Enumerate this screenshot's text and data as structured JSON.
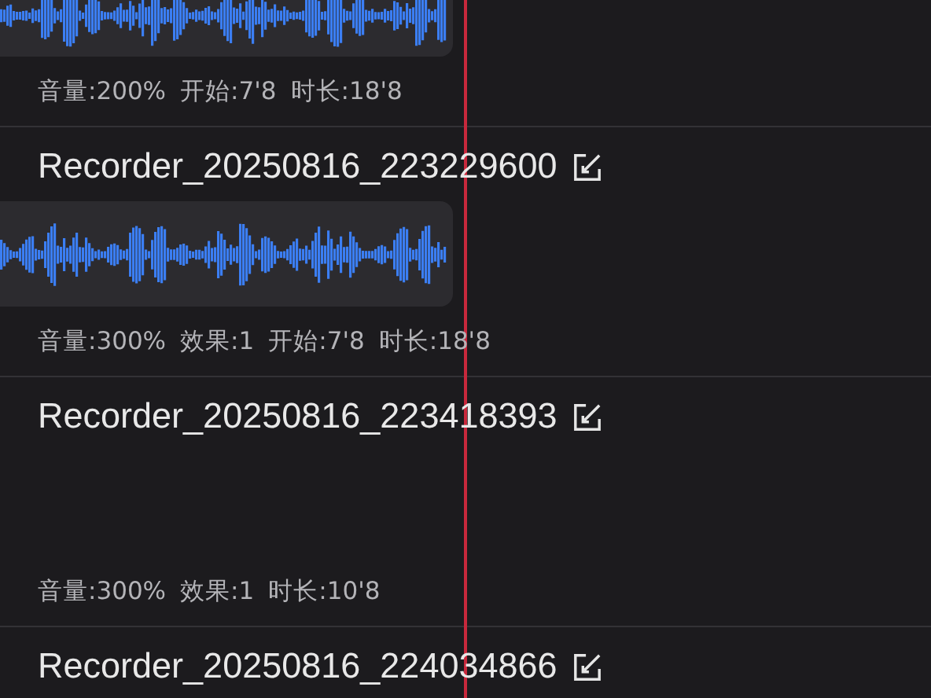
{
  "recordings": [
    {
      "waveform": true,
      "stats": [
        "音量:200%",
        "开始:7'8",
        "时长:18'8"
      ]
    },
    {
      "name": "Recorder_20250816_223229600",
      "waveform": true,
      "stats": [
        "音量:300%",
        "效果:1",
        "开始:7'8",
        "时长:18'8"
      ]
    },
    {
      "name": "Recorder_20250816_223418393",
      "waveform": false,
      "stats": [
        "音量:300%",
        "效果:1",
        "时长:10'8"
      ]
    },
    {
      "name": "Recorder_20250816_224034866"
    }
  ]
}
